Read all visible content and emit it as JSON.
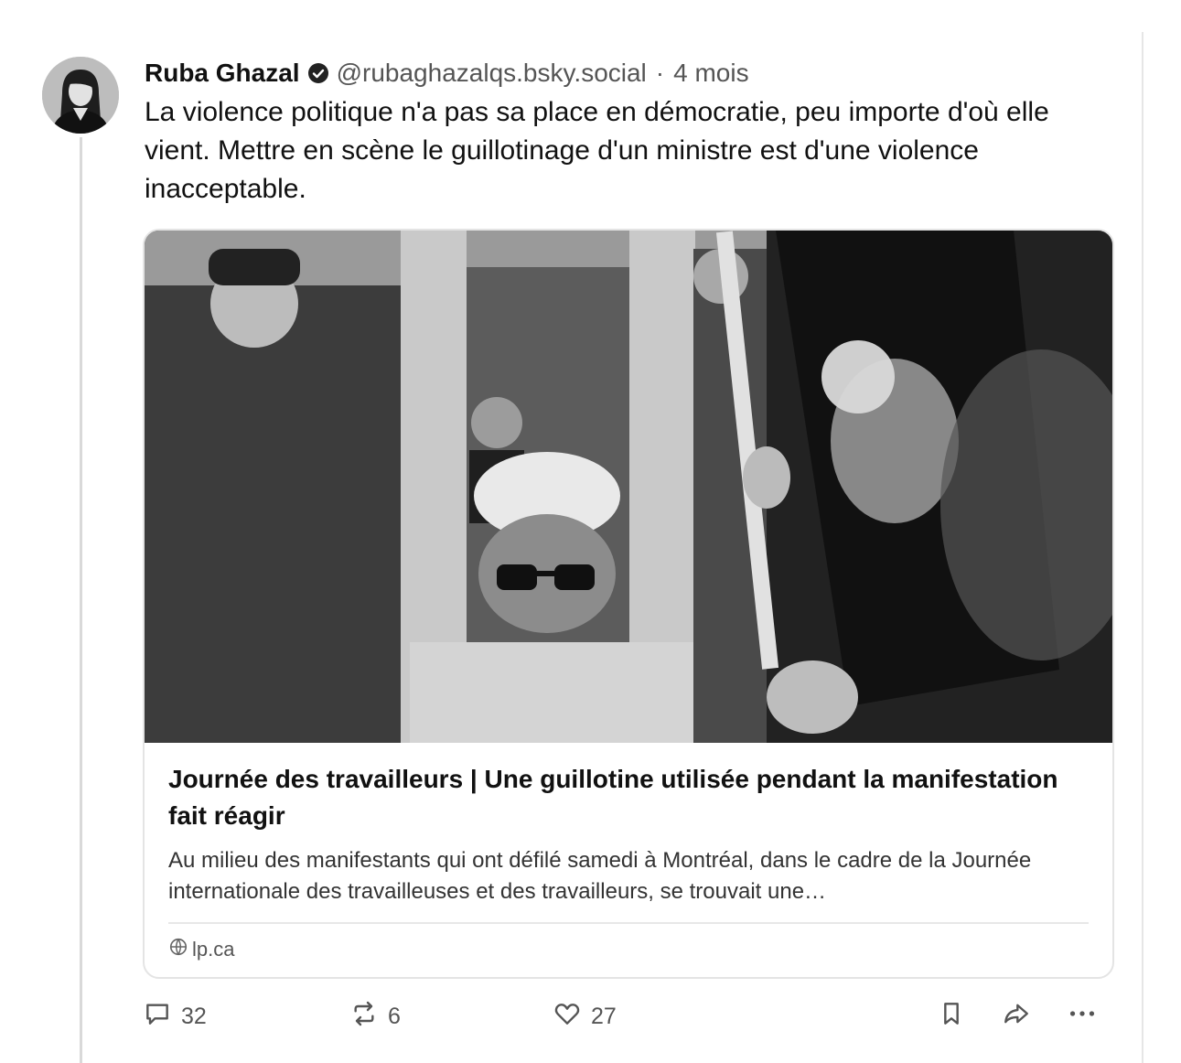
{
  "post": {
    "author_name": "Ruba Ghazal",
    "handle": "@rubaghazalqs.bsky.social",
    "separator": "·",
    "time": "4 mois",
    "text": "La violence politique n'a pas sa place en démocratie, peu importe d'où elle vient. Mettre en scène le guillotinage d'un ministre est d'une violence inacceptable."
  },
  "link_card": {
    "title": "Journée des travailleurs | Une guillotine utilisée pendant la manifestation fait réagir",
    "description": "Au milieu des manifestants qui ont défilé samedi à Montréal, dans le cadre de la Journée internationale des travailleuses et des travailleurs, se trouvait une…",
    "domain": "lp.ca"
  },
  "actions": {
    "reply_count": "32",
    "repost_count": "6",
    "like_count": "27"
  },
  "icons": {
    "verified": "verified-badge-icon",
    "reply": "comment-icon",
    "repost": "repost-icon",
    "like": "heart-icon",
    "bookmark": "bookmark-icon",
    "share": "share-icon",
    "more": "more-icon",
    "globe": "globe-icon"
  },
  "colors": {
    "text": "#111111",
    "muted": "#555555",
    "border": "#e4e4e4"
  }
}
